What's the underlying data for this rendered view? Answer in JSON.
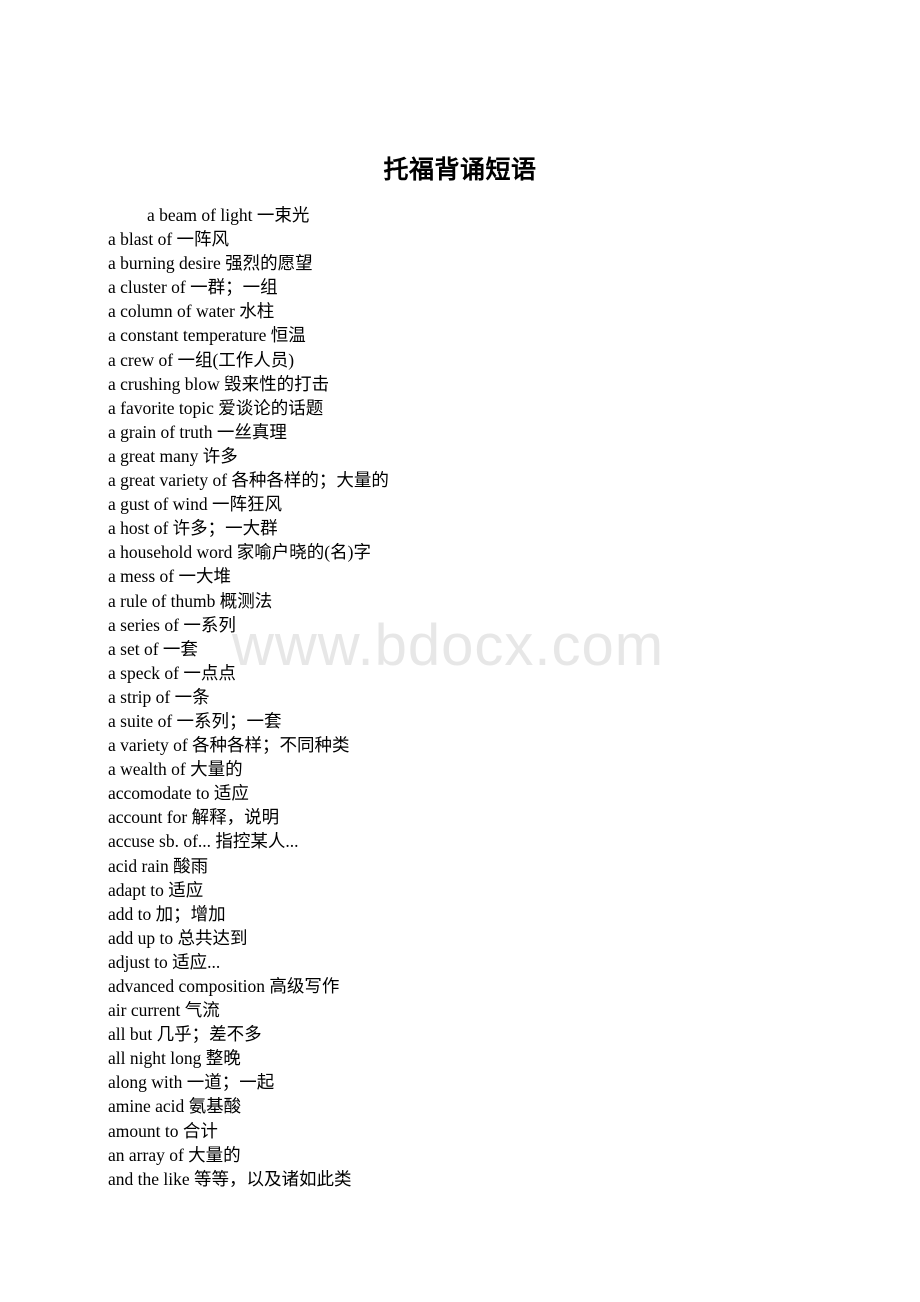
{
  "document": {
    "title": "托福背诵短语",
    "watermark": "www.bdocx.com"
  },
  "phrases": [
    {
      "text": "a beam of light 一束光",
      "indented": true
    },
    {
      "text": "a blast of 一阵风",
      "indented": false
    },
    {
      "text": "a burning desire 强烈的愿望",
      "indented": false
    },
    {
      "text": "a cluster of 一群；一组",
      "indented": false
    },
    {
      "text": "a column of water 水柱",
      "indented": false
    },
    {
      "text": "a constant temperature 恒温",
      "indented": false
    },
    {
      "text": "a crew of 一组(工作人员)",
      "indented": false
    },
    {
      "text": "a crushing blow 毁来性的打击",
      "indented": false
    },
    {
      "text": "a favorite topic 爱谈论的话题",
      "indented": false
    },
    {
      "text": "a grain of truth 一丝真理",
      "indented": false
    },
    {
      "text": "a great many 许多",
      "indented": false
    },
    {
      "text": "a great variety of 各种各样的；大量的",
      "indented": false
    },
    {
      "text": "a gust of wind 一阵狂风",
      "indented": false
    },
    {
      "text": "a host of 许多；一大群",
      "indented": false
    },
    {
      "text": "a household word 家喻户晓的(名)字",
      "indented": false
    },
    {
      "text": "a mess of 一大堆",
      "indented": false
    },
    {
      "text": "a rule of thumb 概测法",
      "indented": false
    },
    {
      "text": "a series of 一系列",
      "indented": false
    },
    {
      "text": "a set of 一套",
      "indented": false
    },
    {
      "text": "a speck of 一点点",
      "indented": false
    },
    {
      "text": "a strip of 一条",
      "indented": false
    },
    {
      "text": "a suite of 一系列；一套",
      "indented": false
    },
    {
      "text": "a variety of 各种各样；不同种类",
      "indented": false
    },
    {
      "text": "a wealth of 大量的",
      "indented": false
    },
    {
      "text": "accomodate to 适应",
      "indented": false
    },
    {
      "text": "account for 解释，说明",
      "indented": false
    },
    {
      "text": "accuse sb. of... 指控某人...",
      "indented": false
    },
    {
      "text": "acid rain 酸雨",
      "indented": false
    },
    {
      "text": "adapt to 适应",
      "indented": false
    },
    {
      "text": "add to 加；增加",
      "indented": false
    },
    {
      "text": "add up to 总共达到",
      "indented": false
    },
    {
      "text": "adjust to 适应...",
      "indented": false
    },
    {
      "text": "advanced composition 高级写作",
      "indented": false
    },
    {
      "text": "air current 气流",
      "indented": false
    },
    {
      "text": "all but 几乎；差不多",
      "indented": false
    },
    {
      "text": "all night long 整晚",
      "indented": false
    },
    {
      "text": "along with 一道；一起",
      "indented": false
    },
    {
      "text": "amine acid 氨基酸",
      "indented": false
    },
    {
      "text": "amount to 合计",
      "indented": false
    },
    {
      "text": "an array of 大量的",
      "indented": false
    },
    {
      "text": "and the like 等等，以及诸如此类",
      "indented": false
    }
  ]
}
